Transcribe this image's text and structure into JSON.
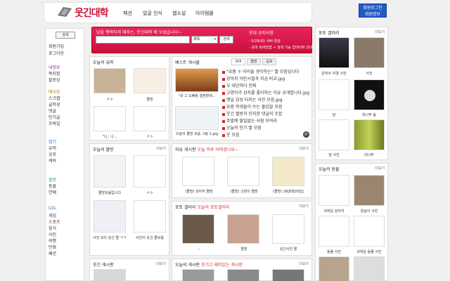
{
  "header": {
    "logo_text": "웃긴대학",
    "nav": [
      "패션",
      "얼굴 인식",
      "웹소설",
      "아이템몰"
    ]
  },
  "corner_button": {
    "line1": "회원로그인",
    "line2": "회원정보"
  },
  "left": {
    "search_btn": "검색",
    "items": [
      "회원가입",
      "로그아웃",
      "내정보",
      "쪽지함",
      "팔로잉",
      "메모장",
      "스크랩",
      "글작성",
      "댓글",
      "인기글",
      "모바일",
      "엽기",
      "유머",
      "공포",
      "캐릭",
      "짤방",
      "동물",
      "연예",
      "LOL",
      "게임",
      "스포츠",
      "음식",
      "사진",
      "여행",
      "만화",
      "패션"
    ]
  },
  "hero": {
    "greeting": "남을 행복하게 해주는, 웃긴대학 에 오셨습니다~",
    "select_label": "제목",
    "search_label": "검색",
    "notice_title": "웃대 공지사항",
    "notices": [
      "- 5/28(화) 서버 점검",
      "- 웃대 모바일앱 + 검색 기능 업데이트 안내"
    ]
  },
  "box1": {
    "title": "오늘의 유머",
    "more": "더보기",
    "captions": [
      "ㅈㅇ",
      "짤방",
      "\"나.. 나...",
      "ㅈㅇ"
    ]
  },
  "box2": {
    "title": "베스트 게시물",
    "tabs": [
      "유머",
      "짤방",
      "공포"
    ],
    "thumbs": [
      "\"내 그 오빠랑 결혼할래...",
      "오늘의 짤방 모음 그림 1.jpg"
    ],
    "list": [
      "\"요즘 ㅎ 아이들 생각하는\" 짤 모음입니다",
      "강아지 어린시절과 지금 비교.jpg",
      "오 대단하다 진짜",
      "고양이가 상자를 좋아하는 이유 공개합니다.jpg",
      "옛날 감성 터지는 사진 모음.jpg",
      "요즘 학생들이 쓰는 줄임말 모음",
      "웃긴 짤방과 진지한 댓글의 조합",
      "주말에 할일없는 사람 모여라",
      "오늘의 인기 짤 모음",
      "웃 모음"
    ]
  },
  "box3": {
    "title": "오늘의 짤방",
    "more": "더보기",
    "captions": [
      "짤방모음입니다",
      "ㅇㅇ",
      "사진 보다 웃긴 짤 ㅋㅋ",
      "사진이 웃긴 짤모음"
    ]
  },
  "box4": {
    "title": "자유 게시판",
    "subtitle": "오늘 하루 어떠셨나요~",
    "more": "더보기",
    "captions": [
      "(짤방) 강아지 짤방",
      "(짤방) 고양이 짤방",
      "(짤방) 26[8월20일]"
    ]
  },
  "box5": {
    "title": "포토 갤러리",
    "subtitle": "오늘의 포토갤러리",
    "more": "더보기",
    "captions": "",
    "cap_list": [
      "...",
      "짤방",
      "웃긴사진 짤"
    ]
  },
  "box6": {
    "title": "웃긴 게시판",
    "more": "더보기"
  },
  "box7": {
    "title": "오늘의 게시판",
    "subtitle": "웃기고 재미있는 게시판",
    "more": "더보기"
  },
  "right1": {
    "title": "포토 갤러리",
    "more": "더보기",
    "captions": [
      "은하수 야경 사진",
      "사진",
      "달",
      "대나무 숲",
      "달 사진",
      "대나무"
    ]
  },
  "right2": {
    "title": "오늘의 동물",
    "more": "더보기",
    "captions": [
      "귀여운 강아지",
      "원숭이 사진",
      "동물 사진",
      "귀여운 동물 사진"
    ]
  }
}
